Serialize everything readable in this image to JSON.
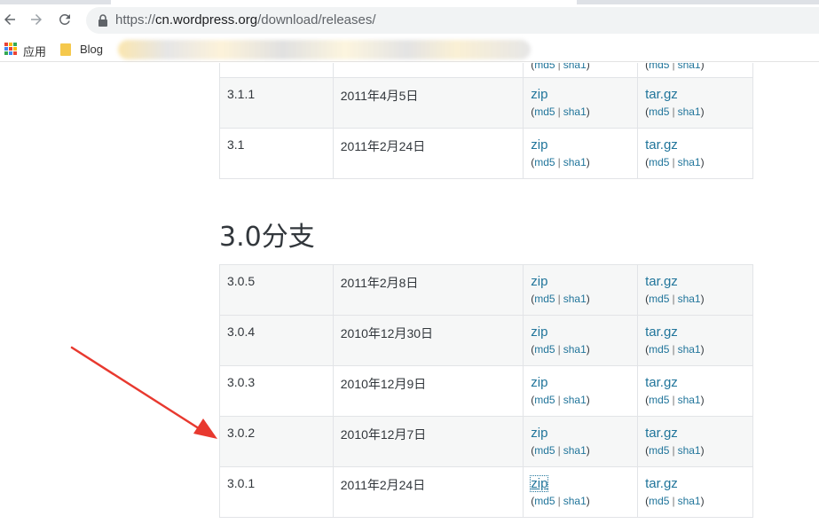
{
  "browser": {
    "url_prefix": "https://",
    "url_host": "cn.wordpress.org",
    "url_path": "/download/releases/",
    "bookmarks": {
      "apps_label": "应用",
      "blog_label": "Blog"
    }
  },
  "branch_31": {
    "rows": [
      {
        "version": "3.1.1",
        "date": "2011年4月5日",
        "zip": "zip",
        "tar": "tar.gz",
        "md5": "md5",
        "sha1": "sha1"
      },
      {
        "version": "3.1",
        "date": "2011年2月24日",
        "zip": "zip",
        "tar": "tar.gz",
        "md5": "md5",
        "sha1": "sha1"
      }
    ]
  },
  "branch_30": {
    "title": "3.0分支",
    "rows": [
      {
        "version": "3.0.5",
        "date": "2011年2月8日",
        "zip": "zip",
        "tar": "tar.gz",
        "md5": "md5",
        "sha1": "sha1"
      },
      {
        "version": "3.0.4",
        "date": "2010年12月30日",
        "zip": "zip",
        "tar": "tar.gz",
        "md5": "md5",
        "sha1": "sha1"
      },
      {
        "version": "3.0.3",
        "date": "2010年12月9日",
        "zip": "zip",
        "tar": "tar.gz",
        "md5": "md5",
        "sha1": "sha1"
      },
      {
        "version": "3.0.2",
        "date": "2010年12月7日",
        "zip": "zip",
        "tar": "tar.gz",
        "md5": "md5",
        "sha1": "sha1"
      },
      {
        "version": "3.0.1",
        "date": "2011年2月24日",
        "zip": "zip",
        "tar": "tar.gz",
        "md5": "md5",
        "sha1": "sha1"
      }
    ]
  },
  "annotation": {
    "arrow_color": "#e8392f"
  }
}
